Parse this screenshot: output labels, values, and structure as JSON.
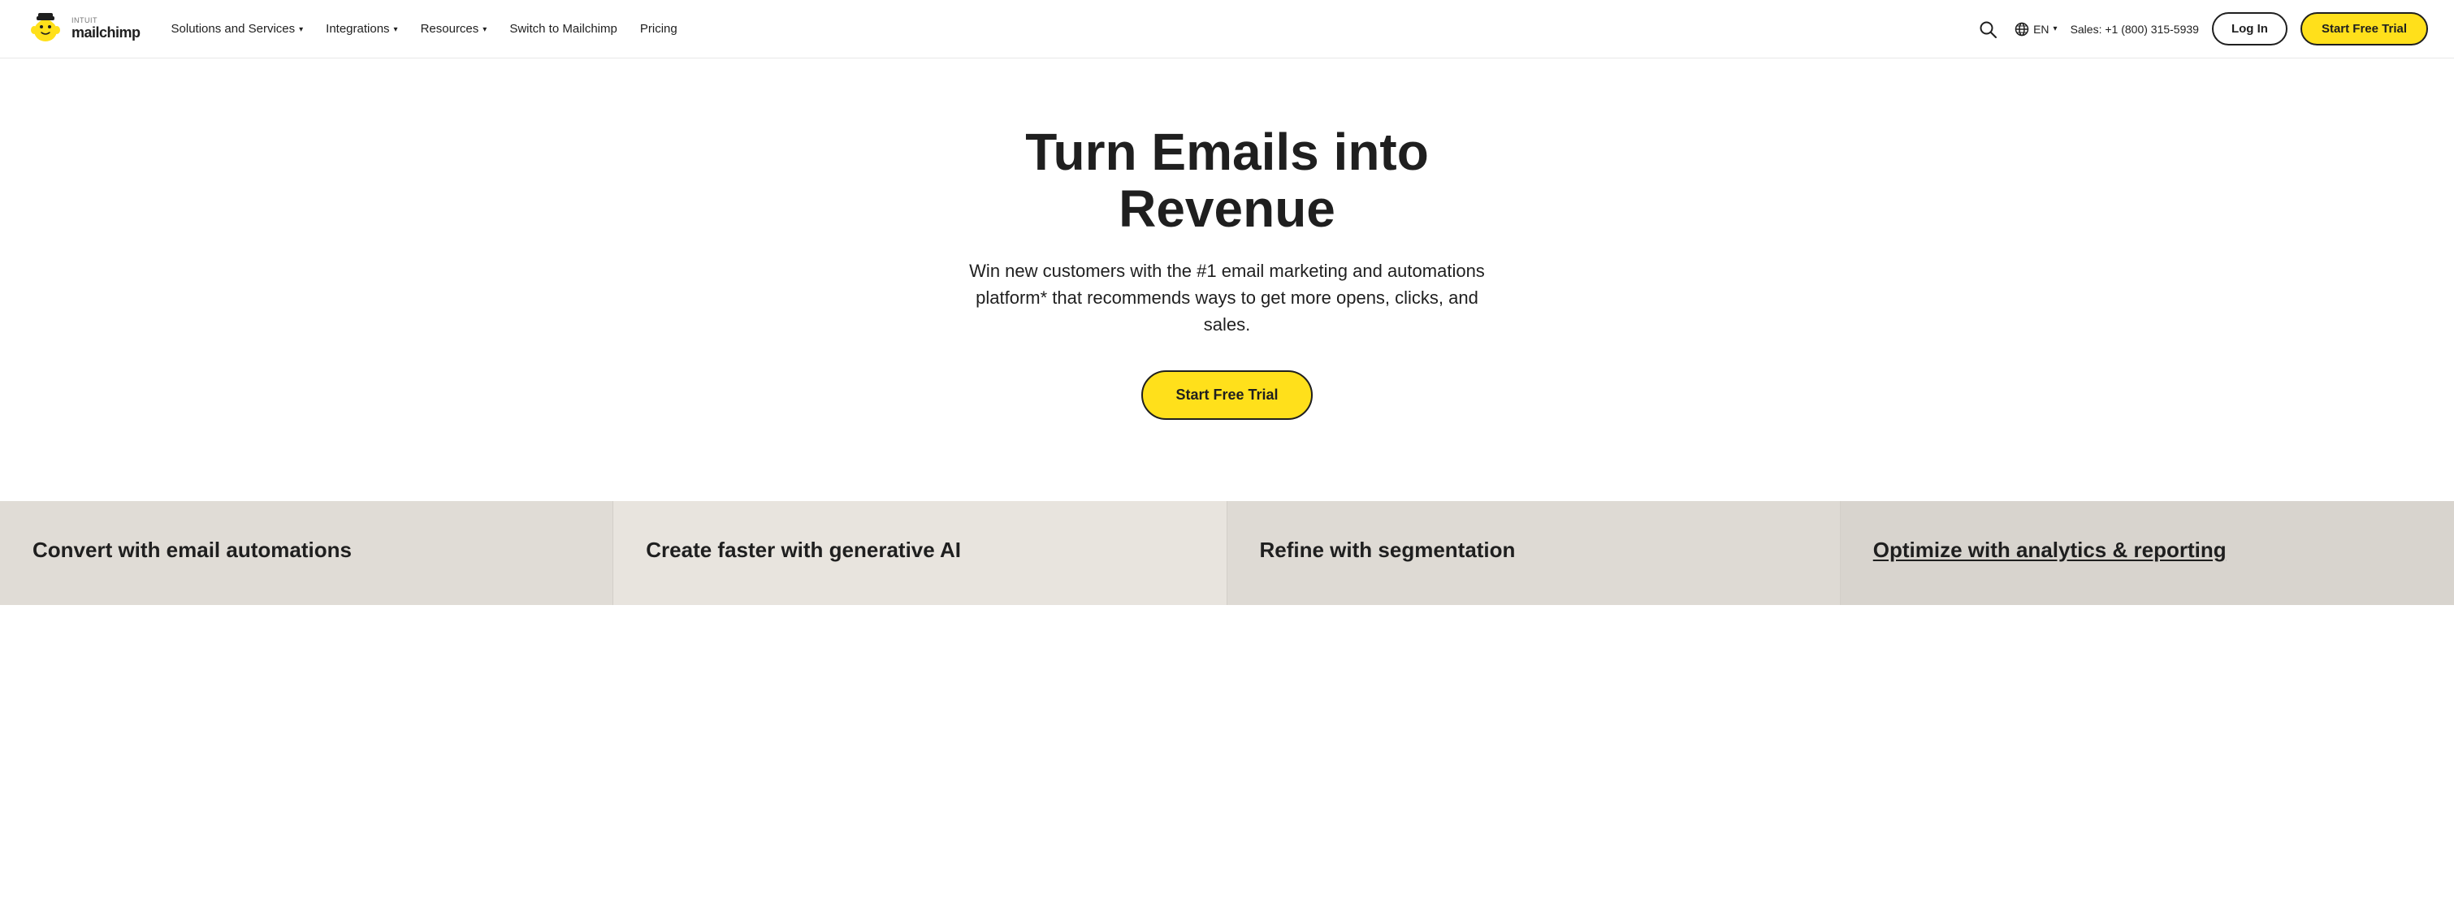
{
  "nav": {
    "logo_alt": "Intuit Mailchimp",
    "links": [
      {
        "id": "solutions",
        "label": "Solutions and Services",
        "has_dropdown": true
      },
      {
        "id": "integrations",
        "label": "Integrations",
        "has_dropdown": true
      },
      {
        "id": "resources",
        "label": "Resources",
        "has_dropdown": true
      },
      {
        "id": "switch",
        "label": "Switch to Mailchimp",
        "has_dropdown": false
      },
      {
        "id": "pricing",
        "label": "Pricing",
        "has_dropdown": false
      }
    ],
    "lang": "EN",
    "sales": "Sales: +1 (800) 315-5939",
    "login_label": "Log In",
    "start_label": "Start Free Trial"
  },
  "hero": {
    "title": "Turn Emails into Revenue",
    "subtitle": "Win new customers with the #1 email marketing and automations platform* that recommends ways to get more opens, clicks, and sales.",
    "cta_label": "Start Free Trial"
  },
  "features": [
    {
      "id": "email-automations",
      "label": "Convert with email automations",
      "underlined": false
    },
    {
      "id": "generative-ai",
      "label": "Create faster with generative AI",
      "underlined": false
    },
    {
      "id": "segmentation",
      "label": "Refine with segmentation",
      "underlined": false
    },
    {
      "id": "analytics",
      "label": "Optimize with analytics & reporting",
      "underlined": true
    }
  ]
}
